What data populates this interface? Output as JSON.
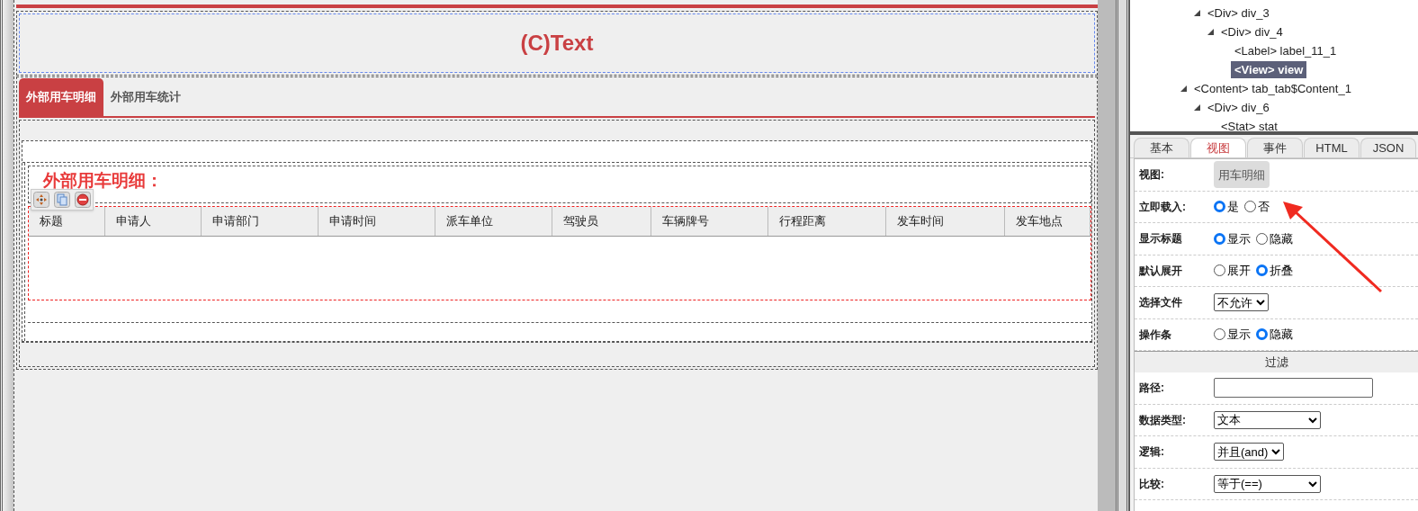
{
  "canvas": {
    "title": "(C)Text",
    "tabs": [
      {
        "label": "外部用车明细",
        "selected": true
      },
      {
        "label": "外部用车统计",
        "selected": false
      }
    ],
    "view_label": "外部用车明细：",
    "table": {
      "columns": [
        "标题",
        "申请人",
        "申请部门",
        "申请时间",
        "派车单位",
        "驾驶员",
        "车辆牌号",
        "行程距离",
        "发车时间",
        "发车地点"
      ]
    }
  },
  "tree": {
    "items": [
      {
        "children": [
          {
            "label": "<Div> div_3",
            "expanded": true,
            "selected": false,
            "children": [
              {
                "label": "<Div> div_4",
                "expanded": true,
                "selected": false,
                "children": [
                  {
                    "label": "<Label> label_11_1",
                    "selected": false
                  },
                  {
                    "label": "<View> view",
                    "selected": true
                  }
                ]
              }
            ]
          }
        ]
      },
      {
        "label": "<Content> tab_tab$Content_1",
        "expanded": true,
        "selected": false,
        "children": [
          {
            "label": "<Div> div_6",
            "expanded": true,
            "selected": false,
            "children": [
              {
                "label": "<Stat> stat",
                "selected": false
              }
            ]
          }
        ]
      }
    ]
  },
  "panel_tabs": [
    {
      "label": "基本",
      "selected": false
    },
    {
      "label": "视图",
      "selected": true
    },
    {
      "label": "事件",
      "selected": false
    },
    {
      "label": "HTML",
      "selected": false
    },
    {
      "label": "JSON",
      "selected": false
    }
  ],
  "properties": [
    {
      "kind": "button",
      "label": "视图:",
      "value": "用车明细"
    },
    {
      "kind": "radio",
      "label": "立即载入:",
      "options": [
        {
          "label": "是",
          "selected": true
        },
        {
          "label": "否",
          "selected": false
        }
      ]
    },
    {
      "kind": "radio",
      "label": "显示标题",
      "options": [
        {
          "label": "显示",
          "selected": true
        },
        {
          "label": "隐藏",
          "selected": false
        }
      ]
    },
    {
      "kind": "radio",
      "label": "默认展开",
      "options": [
        {
          "label": "展开",
          "selected": false
        },
        {
          "label": "折叠",
          "selected": true
        }
      ]
    },
    {
      "kind": "select",
      "label": "选择文件",
      "value": "不允许"
    },
    {
      "kind": "radio",
      "label": "操作条",
      "options": [
        {
          "label": "显示",
          "selected": false
        },
        {
          "label": "隐藏",
          "selected": true
        }
      ]
    },
    {
      "kind": "section",
      "label": "过滤"
    },
    {
      "kind": "input",
      "label": "路径:"
    },
    {
      "kind": "select",
      "label": "数据类型:",
      "value": "文本",
      "wide": true
    },
    {
      "kind": "select",
      "label": "逻辑:",
      "value": "并且(and)"
    },
    {
      "kind": "select",
      "label": "比较:",
      "value": "等于(==)",
      "wide": true
    }
  ]
}
